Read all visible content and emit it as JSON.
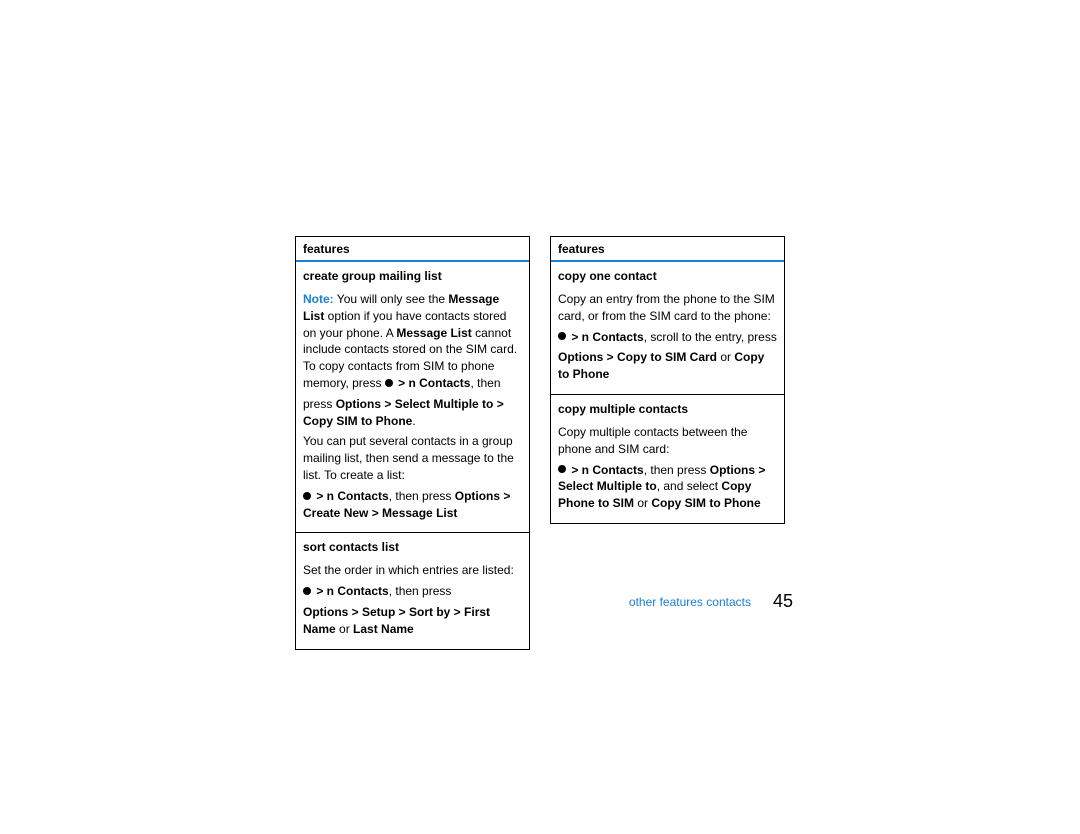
{
  "left": {
    "header": "features",
    "sections": [
      {
        "title": "create group mailing list",
        "noteLabel": "Note:",
        "note1a": " You will only see the ",
        "bold1": "Message List",
        "note1b": " option if you have contacts stored on your phone. A ",
        "bold2": "Message List",
        "note1c": " cannot include contacts stored on the SIM card. To copy contacts from SIM to phone memory, press ",
        "navPath1": " > n    Contacts",
        "note1d": ", then",
        "line2a": "press ",
        "bold3": "Options > Select Multiple to > Copy SIM to Phone",
        "line2b": ".",
        "para2": "You can put several contacts in a group mailing list, then send a message to the list. To create a list:",
        "navPath2": " > n    Contacts",
        "line3a": ", then press ",
        "bold4": "Options > Create New > Message List"
      },
      {
        "title": "sort contacts list",
        "para1": "Set the order in which entries are listed:",
        "navPath": " > n    Contacts",
        "line1a": ", then press",
        "bold1": "Options > Setup > Sort by > First Name",
        "mid": " or ",
        "bold2": "Last Name"
      }
    ]
  },
  "right": {
    "header": "features",
    "sections": [
      {
        "title": "copy one contact",
        "para1": "Copy an entry from the phone to the SIM card, or from the SIM card to the phone:",
        "navPath": " > n    Contacts",
        "line1a": ", scroll to the entry, press",
        "bold1": "Options > Copy to SIM Card",
        "mid": " or ",
        "bold2": "Copy to Phone"
      },
      {
        "title": "copy multiple contacts",
        "para1": "Copy multiple contacts between the phone and SIM card:",
        "navPath": " > n    Contacts",
        "line1a": ", then press ",
        "bold1": "Options > Select Multiple to",
        "line1b": ", and select ",
        "bold2": "Copy Phone to SIM",
        "mid": " or ",
        "bold3": "Copy SIM to Phone"
      }
    ]
  },
  "footer": {
    "section": "other  features contacts",
    "page": "45"
  }
}
